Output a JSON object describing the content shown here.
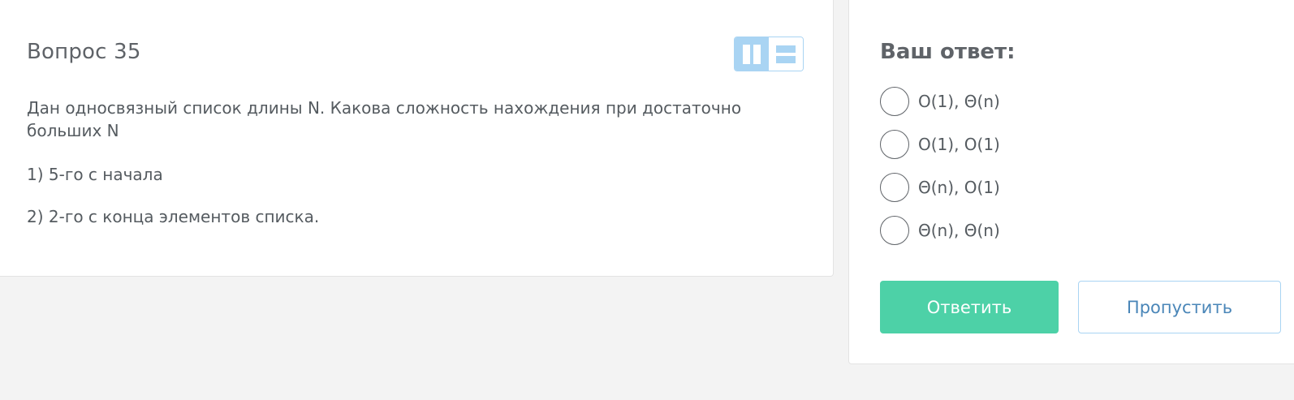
{
  "question": {
    "title": "Вопрос 35",
    "text": "Дан односвязный список длины N. Какова сложность нахождения при достаточно больших N",
    "lines": [
      "1) 5-го с начала",
      "2) 2-го с конца элементов списка."
    ]
  },
  "layout_toggle": {
    "active": "columns",
    "active_color": "#a9d4f3"
  },
  "answer": {
    "title": "Ваш ответ:",
    "options": [
      {
        "label": "O(1), Θ(n)",
        "selected": false
      },
      {
        "label": "O(1), O(1)",
        "selected": false
      },
      {
        "label": "Θ(n), O(1)",
        "selected": false
      },
      {
        "label": "Θ(n), Θ(n)",
        "selected": false
      }
    ],
    "submit_label": "Ответить",
    "skip_label": "Пропустить"
  },
  "colors": {
    "accent_green": "#4dd1a7",
    "accent_blue": "#4a86b8",
    "border_blue": "#a9d4f3"
  },
  "icons": {
    "columns": "columns-layout-icon",
    "rows": "rows-layout-icon"
  }
}
